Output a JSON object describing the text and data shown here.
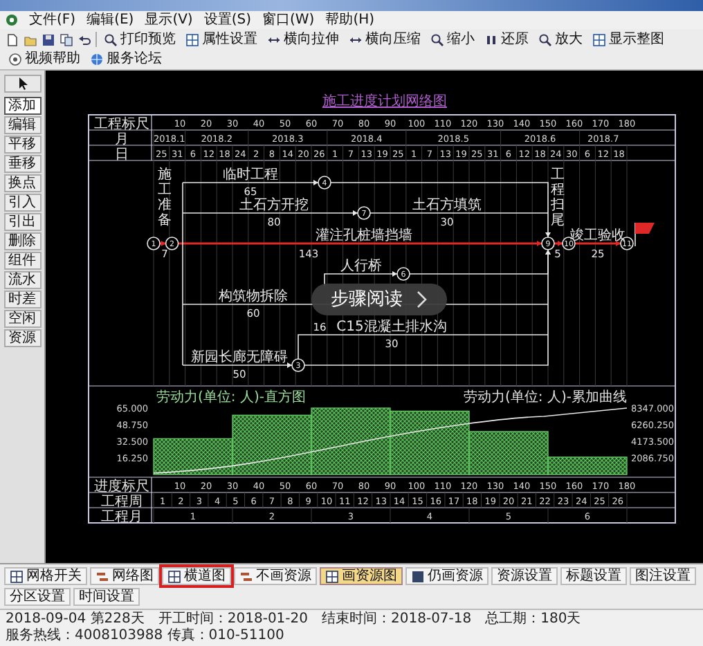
{
  "menu": [
    "文件(F)",
    "编辑(E)",
    "显示(V)",
    "设置(S)",
    "窗口(W)",
    "帮助(H)"
  ],
  "toolbar": [
    "打印预览",
    "属性设置",
    "横向拉伸",
    "横向压缩",
    "缩小",
    "还原",
    "放大",
    "显示整图",
    "视频帮助",
    "服务论坛"
  ],
  "tools": [
    {
      "label": "添加",
      "selected": true
    },
    {
      "label": "编辑",
      "selected": false
    },
    {
      "label": "平移",
      "selected": false
    },
    {
      "label": "垂移",
      "selected": false
    },
    {
      "label": "换点",
      "selected": false
    },
    {
      "label": "引入",
      "selected": false
    },
    {
      "label": "引出",
      "selected": false
    },
    {
      "label": "删除",
      "selected": false
    },
    {
      "label": "组件",
      "selected": false
    },
    {
      "label": "流水",
      "selected": false
    },
    {
      "label": "时差",
      "selected": false
    },
    {
      "label": "空闲",
      "selected": false
    },
    {
      "label": "资源",
      "selected": false
    }
  ],
  "chart": {
    "title": "施工进度计划网络图",
    "scale_label": "工程标尺",
    "scale": [
      "10",
      "20",
      "30",
      "40",
      "50",
      "60",
      "70",
      "80",
      "90",
      "100",
      "110",
      "120",
      "130",
      "140",
      "150",
      "160",
      "170",
      "180"
    ],
    "month_label": "月",
    "day_label": "日",
    "months": [
      {
        "label": "2018.1",
        "days": [
          "25",
          "31"
        ]
      },
      {
        "label": "2018.2",
        "days": [
          "6",
          "12",
          "18",
          "24"
        ]
      },
      {
        "label": "2018.3",
        "days": [
          "2",
          "8",
          "14",
          "20",
          "26"
        ]
      },
      {
        "label": "2018.4",
        "days": [
          "1",
          "7",
          "13",
          "19",
          "25"
        ]
      },
      {
        "label": "2018.5",
        "days": [
          "1",
          "7",
          "13",
          "19",
          "25",
          "31"
        ]
      },
      {
        "label": "2018.6",
        "days": [
          "6",
          "12",
          "18",
          "24",
          "30"
        ]
      },
      {
        "label": "2018.7",
        "days": [
          "6",
          "12",
          "18"
        ]
      }
    ],
    "nodes": [
      "1",
      "2",
      "4",
      "7",
      "6",
      "3",
      "9",
      "10",
      "11"
    ],
    "activities": [
      {
        "kind": "activity",
        "name": "临时工程",
        "duration": "65"
      },
      {
        "kind": "activity",
        "name": "土石方开挖",
        "duration": "80"
      },
      {
        "kind": "activity",
        "name": "土石方填筑",
        "duration": "30"
      },
      {
        "kind": "activity",
        "name": "灌注孔桩墙挡墙",
        "duration": "143"
      },
      {
        "kind": "activity",
        "name": "人行桥"
      },
      {
        "kind": "activity",
        "name": "构筑物拆除",
        "duration": "60"
      },
      {
        "kind": "activity",
        "duration": "16"
      },
      {
        "kind": "activity",
        "name": "C15混凝土排水沟",
        "duration": "30"
      },
      {
        "kind": "activity",
        "name": "新园长廊无障碍",
        "duration": "50"
      },
      {
        "kind": "vertical",
        "name": "施工准备",
        "duration": "7"
      },
      {
        "kind": "vertical",
        "name": "工程扫尾",
        "duration": "5"
      },
      {
        "kind": "activity",
        "name": "竣工验收",
        "duration": "25"
      }
    ],
    "labor": {
      "chart_data": {
        "type": "bar",
        "categories": [
          null,
          null,
          null,
          null,
          null,
          null
        ],
        "ylim": [
          0,
          65
        ],
        "yticks": [
          {
            "value": 65,
            "label": "65.000"
          },
          {
            "value": 48.75,
            "label": "48.750"
          },
          {
            "value": 32.5,
            "label": "32.500"
          },
          {
            "value": 16.25,
            "label": "16.250"
          }
        ],
        "series": [
          {
            "name": "劳动力(单位: 人)-直方图",
            "color": "#5fc85f",
            "values": [
              35,
              58,
              65,
              62,
              42,
              17
            ]
          }
        ]
      },
      "curve_title": "劳动力(单位: 人)-累加曲线",
      "curve_labels": [
        "8347.000",
        "6260.250",
        "4173.500",
        "2086.750"
      ]
    },
    "progress_label": "进度标尺",
    "progress_scale": [
      "10",
      "20",
      "30",
      "40",
      "50",
      "60",
      "70",
      "80",
      "90",
      "100",
      "110",
      "120",
      "130",
      "140",
      "150",
      "160",
      "170",
      "180"
    ],
    "week_label": "工程周",
    "weeks": [
      "1",
      "2",
      "3",
      "4",
      "5",
      "6",
      "7",
      "8",
      "9",
      "10",
      "11",
      "12",
      "13",
      "14",
      "15",
      "16",
      "17",
      "18",
      "19",
      "20",
      "21",
      "22",
      "23",
      "24",
      "25",
      "26"
    ],
    "month_num_label": "工程月",
    "month_nums": [
      "1",
      "2",
      "3",
      "4",
      "5",
      "6"
    ]
  },
  "overlay": {
    "label": "步骤阅读"
  },
  "tabs": [
    {
      "label": "网格开关",
      "selected": false,
      "highlighted": false
    },
    {
      "label": "网络图",
      "selected": false,
      "highlighted": false
    },
    {
      "label": "横道图",
      "selected": false,
      "highlighted": true
    },
    {
      "label": "不画资源",
      "selected": false,
      "highlighted": false
    },
    {
      "label": "画资源图",
      "selected": true,
      "highlighted": false
    },
    {
      "label": "仍画资源",
      "selected": false,
      "highlighted": false
    },
    {
      "label": "资源设置",
      "selected": false,
      "highlighted": false
    },
    {
      "label": "标题设置",
      "selected": false,
      "highlighted": false
    },
    {
      "label": "图注设置",
      "selected": false,
      "highlighted": false
    },
    {
      "label": "分区设置",
      "selected": false,
      "highlighted": false
    },
    {
      "label": "时间设置",
      "selected": false,
      "highlighted": false
    }
  ],
  "status_bar": [
    "2018-09-04 第228天",
    "开工时间：2018-01-20",
    "结束时间：2018-07-18",
    "总工期：180天",
    "服务热线：4008103988 传真：010-51100"
  ]
}
